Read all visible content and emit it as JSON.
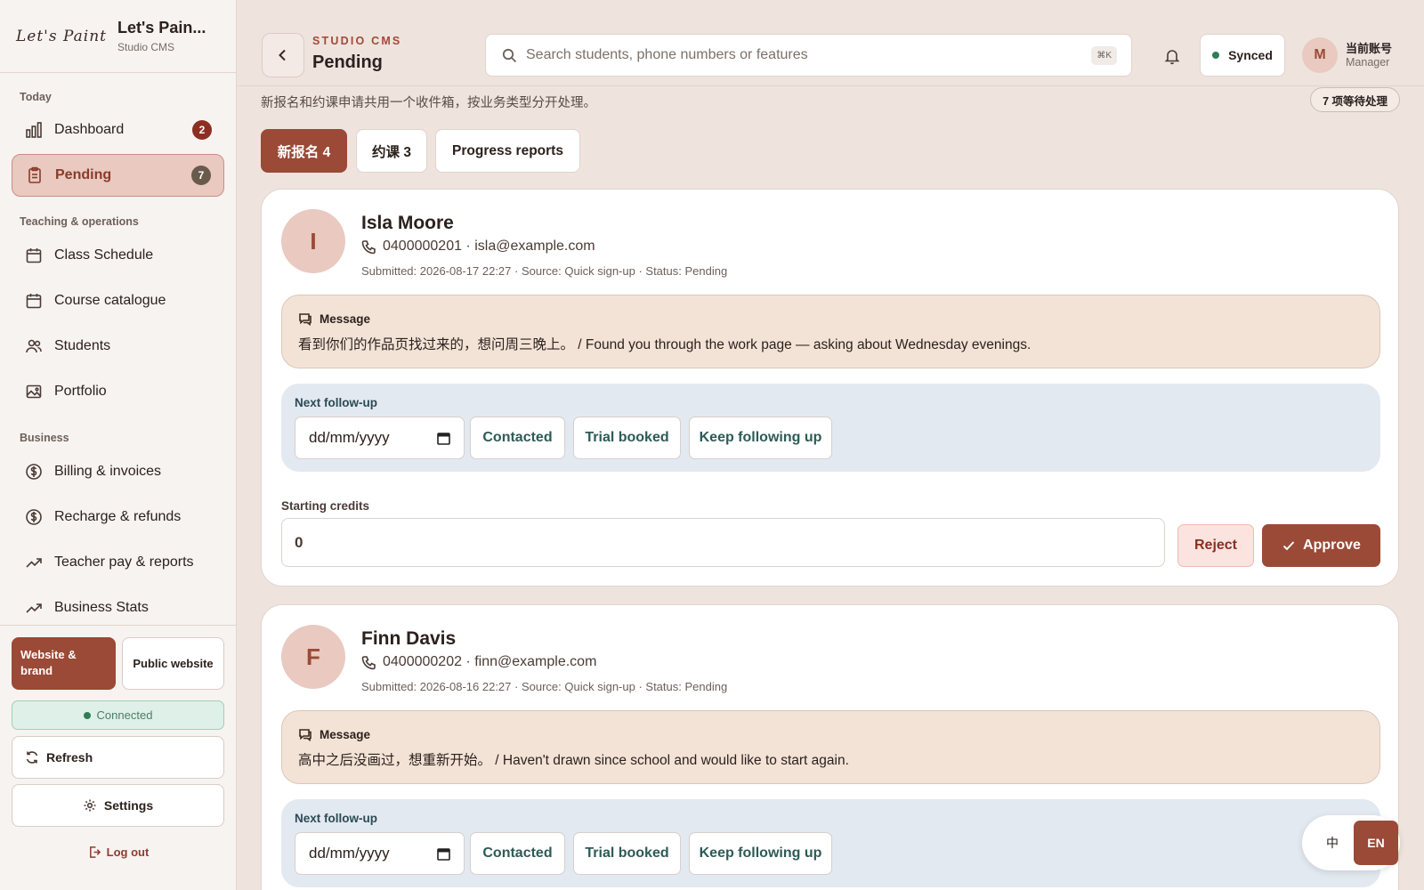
{
  "brand": {
    "logo": "Let's Paint",
    "title": "Let's Pain...",
    "subtitle": "Studio CMS"
  },
  "sidebar": {
    "sections": {
      "today": "Today",
      "teaching": "Teaching & operations",
      "business": "Business"
    },
    "items": [
      {
        "label": "Dashboard",
        "badge": "2",
        "icon": "bar-chart-icon"
      },
      {
        "label": "Pending",
        "badge": "7",
        "icon": "clipboard-icon"
      },
      {
        "label": "Class Schedule",
        "icon": "calendar-icon"
      },
      {
        "label": "Course catalogue",
        "icon": "calendar-icon"
      },
      {
        "label": "Students",
        "icon": "users-icon"
      },
      {
        "label": "Portfolio",
        "icon": "image-icon"
      },
      {
        "label": "Billing & invoices",
        "icon": "dollar-icon"
      },
      {
        "label": "Recharge & refunds",
        "icon": "dollar-icon"
      },
      {
        "label": "Teacher pay & reports",
        "icon": "trend-icon"
      },
      {
        "label": "Business Stats",
        "icon": "trend-icon"
      }
    ],
    "website_brand": "Website & brand",
    "public_website": "Public website",
    "connected": "Connected",
    "refresh": "Refresh",
    "settings": "Settings",
    "logout": "Log out"
  },
  "header": {
    "eyebrow": "STUDIO CMS",
    "title": "Pending",
    "search_placeholder": "Search students, phone numbers or features",
    "shortcut": "⌘K",
    "sync_status": "Synced",
    "account": {
      "initial": "M",
      "name": "当前账号",
      "role": "Manager"
    }
  },
  "main": {
    "intro": "新报名和约课申请共用一个收件箱，按业务类型分开处理。",
    "pending_count": "7 项等待处理",
    "tabs": [
      "新报名 4",
      "约课 3",
      "Progress reports"
    ],
    "labels": {
      "message": "Message",
      "next_followup": "Next follow-up",
      "date_placeholder": "dd/mm/yyyy",
      "contacted": "Contacted",
      "trial_booked": "Trial booked",
      "keep_following": "Keep following up",
      "starting_credits": "Starting credits",
      "reject": "Reject",
      "approve": "Approve"
    },
    "cards": [
      {
        "initial": "I",
        "name": "Isla Moore",
        "contact": "0400000201 · isla@example.com",
        "meta": "Submitted: 2026-08-17 22:27 · Source: Quick sign-up · Status: Pending",
        "message": "看到你们的作品页找过来的，想问周三晚上。 / Found you through the work page — asking about Wednesday evenings.",
        "credits": "0"
      },
      {
        "initial": "F",
        "name": "Finn Davis",
        "contact": "0400000202 · finn@example.com",
        "meta": "Submitted: 2026-08-16 22:27 · Source: Quick sign-up · Status: Pending",
        "message": "高中之后没画过，想重新开始。 / Haven't drawn since school and would like to start again."
      }
    ]
  },
  "language": {
    "zh": "中",
    "en": "EN"
  },
  "colors": {
    "accent": "#9a4a36",
    "badge": "#8c2f22",
    "synced": "#2f7d57",
    "background": "#efe3de"
  }
}
